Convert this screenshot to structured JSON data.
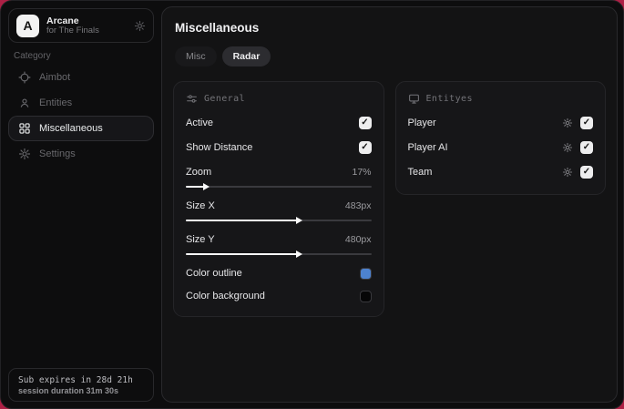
{
  "app": {
    "logo_letter": "A",
    "name": "Arcane",
    "subtitle": "for The Finals"
  },
  "colors": {
    "desktop_bg": "#ad2045",
    "accent_outline": "#4d82cf",
    "accent_background": "#060607"
  },
  "sidebar": {
    "category_label": "Category",
    "items": [
      {
        "label": "Aimbot",
        "icon": "crosshair-icon",
        "active": false
      },
      {
        "label": "Entities",
        "icon": "person-icon",
        "active": false
      },
      {
        "label": "Miscellaneous",
        "icon": "grid-icon",
        "active": true
      },
      {
        "label": "Settings",
        "icon": "gear-icon",
        "active": false
      }
    ],
    "footer": {
      "sub_expires": "Sub expires in 28d 21h",
      "session_duration": "session duration 31m 30s"
    }
  },
  "main": {
    "title": "Miscellaneous",
    "tabs": [
      {
        "label": "Misc",
        "active": false
      },
      {
        "label": "Radar",
        "active": true
      }
    ],
    "general": {
      "header": "General",
      "toggles": [
        {
          "label": "Active",
          "checked": true,
          "check_glyph": "✓"
        },
        {
          "label": "Show Distance",
          "checked": true,
          "check_glyph": "✓"
        }
      ],
      "sliders": [
        {
          "label": "Zoom",
          "value": "17%",
          "fill_percent": 10
        },
        {
          "label": "Size X",
          "value": "483px",
          "fill_percent": 60
        },
        {
          "label": "Size Y",
          "value": "480px",
          "fill_percent": 60
        }
      ],
      "color_rows": [
        {
          "label": "Color outline",
          "color": "#4d82cf"
        },
        {
          "label": "Color background",
          "color": "#060607"
        }
      ]
    },
    "entities": {
      "header": "Entityes",
      "rows": [
        {
          "label": "Player",
          "checked": true,
          "check_glyph": "✓"
        },
        {
          "label": "Player AI",
          "checked": true,
          "check_glyph": "✓"
        },
        {
          "label": "Team",
          "checked": true,
          "check_glyph": "✓"
        }
      ]
    }
  }
}
